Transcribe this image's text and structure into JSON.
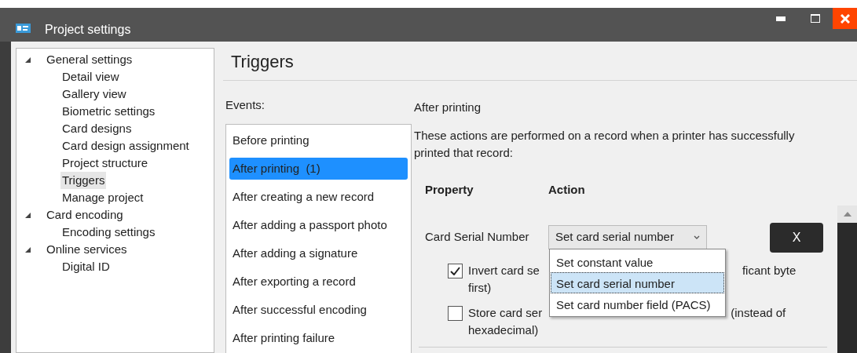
{
  "window": {
    "title": "Project settings"
  },
  "tree": [
    {
      "label": "General settings",
      "expanded": true,
      "selected": false,
      "children": [
        {
          "label": "Detail view",
          "selected": false
        },
        {
          "label": "Gallery view",
          "selected": false
        },
        {
          "label": "Biometric settings",
          "selected": false
        },
        {
          "label": "Card designs",
          "selected": false
        },
        {
          "label": "Card design assignment",
          "selected": false
        },
        {
          "label": "Project structure",
          "selected": false
        },
        {
          "label": "Triggers",
          "selected": true
        },
        {
          "label": "Manage project",
          "selected": false
        }
      ]
    },
    {
      "label": "Card encoding",
      "expanded": true,
      "selected": false,
      "children": [
        {
          "label": "Encoding settings",
          "selected": false
        }
      ]
    },
    {
      "label": "Online services",
      "expanded": true,
      "selected": false,
      "children": [
        {
          "label": "Digital ID",
          "selected": false
        }
      ]
    }
  ],
  "page_title": "Triggers",
  "events": {
    "label": "Events:",
    "items": [
      {
        "label": "Before printing",
        "selected": false
      },
      {
        "label": "After printing  (1)",
        "selected": true
      },
      {
        "label": "After creating a new record",
        "selected": false
      },
      {
        "label": "After adding a passport photo",
        "selected": false
      },
      {
        "label": "After adding a signature",
        "selected": false
      },
      {
        "label": "After exporting a record",
        "selected": false
      },
      {
        "label": "After successful encoding",
        "selected": false
      },
      {
        "label": "After printing failure",
        "selected": false
      }
    ]
  },
  "detail": {
    "title": "After printing",
    "description": "These actions are performed on a record when a printer has successfully printed that record:",
    "columns": [
      "Property",
      "Action"
    ],
    "rows": [
      {
        "property": "Card Serial Number",
        "action": "Set card serial number",
        "remove_button": "X"
      }
    ],
    "dropdown": {
      "expanded": true,
      "options": [
        {
          "label": "Set constant value",
          "selected": false
        },
        {
          "label": "Set card serial number",
          "selected": true
        },
        {
          "label": "Set card number field (PACS)",
          "selected": false
        }
      ]
    },
    "options": [
      {
        "checked": true,
        "label_before": "Invert card se",
        "label_after": "ficant byte",
        "label_next_line": "first)"
      },
      {
        "checked": false,
        "label_before": "Store card ser",
        "label_after": "(instead of",
        "label_next_line": "hexadecimal)"
      }
    ]
  }
}
